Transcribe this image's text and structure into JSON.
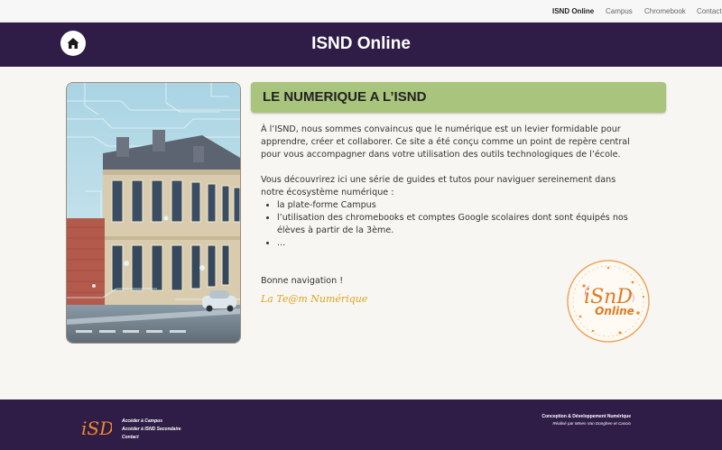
{
  "topnav": {
    "items": [
      {
        "label": "ISND Online",
        "active": true
      },
      {
        "label": "Campus",
        "active": false
      },
      {
        "label": "Chromebook",
        "active": false
      },
      {
        "label": "Contact",
        "active": false
      }
    ]
  },
  "header": {
    "title": "ISND Online",
    "home_icon": "home-icon"
  },
  "main": {
    "heading": "LE NUMERIQUE A L’ISND",
    "intro": "À l’ISND, nous sommes convaincus que le numérique est un levier formidable pour apprendre, créer et collaborer. Ce site a été conçu comme un point de repère central pour vous accompagner dans votre utilisation des outils technologiques de l’école.",
    "list_intro": "Vous découvrirez ici une série de guides et tutos pour naviguer sereinement dans notre écosystème numérique :",
    "list_items": [
      "la plate-forme Campus",
      "l’utilisation des chromebooks et comptes Google scolaires dont sont équipés nos élèves à partir de la 3ème.",
      "..."
    ],
    "greeting": "Bonne navigation !",
    "signature": "La Te@m Numérique"
  },
  "badge": {
    "letters": "iSnD",
    "word": "Online"
  },
  "footer": {
    "logo_letters": "iSD",
    "links": [
      "Accéder à Campus",
      "Accéder à ISND Secondaire",
      "Contact"
    ],
    "credit_title": "Conception & Développement Numérique",
    "credit_sub": "Réalisé par Mmes Van Donghen et Cascio"
  },
  "colors": {
    "header_bg": "#2f1d48",
    "section_head_bg": "#a9c47c",
    "page_bg": "#f8f6f2",
    "accent_orange": "#e0a520"
  }
}
